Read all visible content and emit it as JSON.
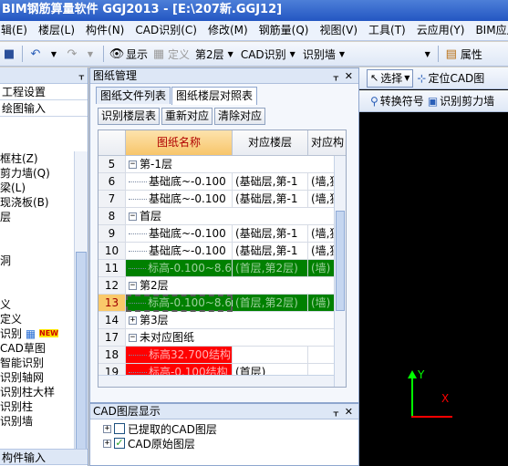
{
  "title": "BIM钢筋算量软件 GGJ2013 - [E:\\207新.GGJ12]",
  "menu": [
    "辑(E)",
    "楼层(L)",
    "构件(N)",
    "CAD识别(C)",
    "修改(M)",
    "钢筋量(Q)",
    "视图(V)",
    "工具(T)",
    "云应用(Y)",
    "BIM应用(I)"
  ],
  "toolbar": {
    "show_label": "显示",
    "define_label": "定义",
    "floor_value": "第2层",
    "cad_value": "CAD识别",
    "wall_value": "识别墙",
    "props_label": "属性"
  },
  "left_panel": {
    "title": "",
    "settings_label": "工程设置",
    "drawing_input_label": "绘图输入",
    "items": [
      "框柱(Z)",
      "剪力墙(Q)",
      "梁(L)",
      "现浇板(B)",
      "层",
      "",
      "",
      "洞",
      "",
      "",
      "义",
      "定义",
      "识别",
      "CAD草图",
      "智能识别",
      "识别轴网",
      "识别柱大样",
      "识别柱",
      "识别墙"
    ],
    "new_badge": "NEW",
    "footer_label": "构件输入"
  },
  "drawing_panel": {
    "title": "图纸管理",
    "tabs": [
      "图纸文件列表",
      "图纸楼层对照表"
    ],
    "buttons": [
      "识别楼层表",
      "重新对应",
      "清除对应"
    ],
    "columns": [
      "图纸名称",
      "对应楼层",
      "对应构"
    ],
    "rows": [
      {
        "num": "5",
        "toggle": "−",
        "name": "第-1层",
        "floor": "",
        "ref": "",
        "style": "group"
      },
      {
        "num": "6",
        "name": "基础底~-0.100",
        "floor": "(基础层,第-1",
        "ref": "(墙,独",
        "style": "child"
      },
      {
        "num": "7",
        "name": "基础底~-0.100",
        "floor": "(基础层,第-1",
        "ref": "(墙,独",
        "style": "child"
      },
      {
        "num": "8",
        "toggle": "−",
        "name": "首层",
        "floor": "",
        "ref": "",
        "style": "group"
      },
      {
        "num": "9",
        "name": "基础底~-0.100",
        "floor": "(基础层,第-1",
        "ref": "(墙,独",
        "style": "child"
      },
      {
        "num": "10",
        "name": "基础底~-0.100",
        "floor": "(基础层,第-1",
        "ref": "(墙,独",
        "style": "child"
      },
      {
        "num": "11",
        "name": "标高-0.100~8.6",
        "floor": "(首层,第2层)",
        "ref": "(墙)",
        "style": "green"
      },
      {
        "num": "12",
        "toggle": "−",
        "name": "第2层",
        "floor": "",
        "ref": "",
        "style": "group"
      },
      {
        "num": "13",
        "name": "标高-0.100~8.6",
        "floor": "(首层,第2层)",
        "ref": "(墙)",
        "style": "green-selected"
      },
      {
        "num": "14",
        "toggle": "+",
        "name": "第3层",
        "floor": "",
        "ref": "",
        "style": "group"
      },
      {
        "num": "17",
        "toggle": "−",
        "name": "未对应图纸",
        "floor": "",
        "ref": "",
        "style": "group"
      },
      {
        "num": "18",
        "name": "标高32.700结构",
        "floor": "",
        "ref": "",
        "style": "red"
      },
      {
        "num": "19",
        "name": "标高-0.100结构",
        "floor": "(首层)",
        "ref": "",
        "style": "red"
      }
    ]
  },
  "cad_panel": {
    "title": "CAD图层显示",
    "items": [
      {
        "label": "已提取的CAD图层",
        "checked": false
      },
      {
        "label": "CAD原始图层",
        "checked": true
      }
    ]
  },
  "right_panel": {
    "select_label": "选择",
    "locate_label": "定位CAD图",
    "convert_label": "转换符号",
    "shear_label": "识别剪力墙",
    "axis_y": "Y",
    "axis_x": "X"
  },
  "colors": {
    "assigned": "#008000",
    "unassigned": "#ff0000",
    "header_accent": "#f7c56a",
    "canvas": "#000000"
  }
}
